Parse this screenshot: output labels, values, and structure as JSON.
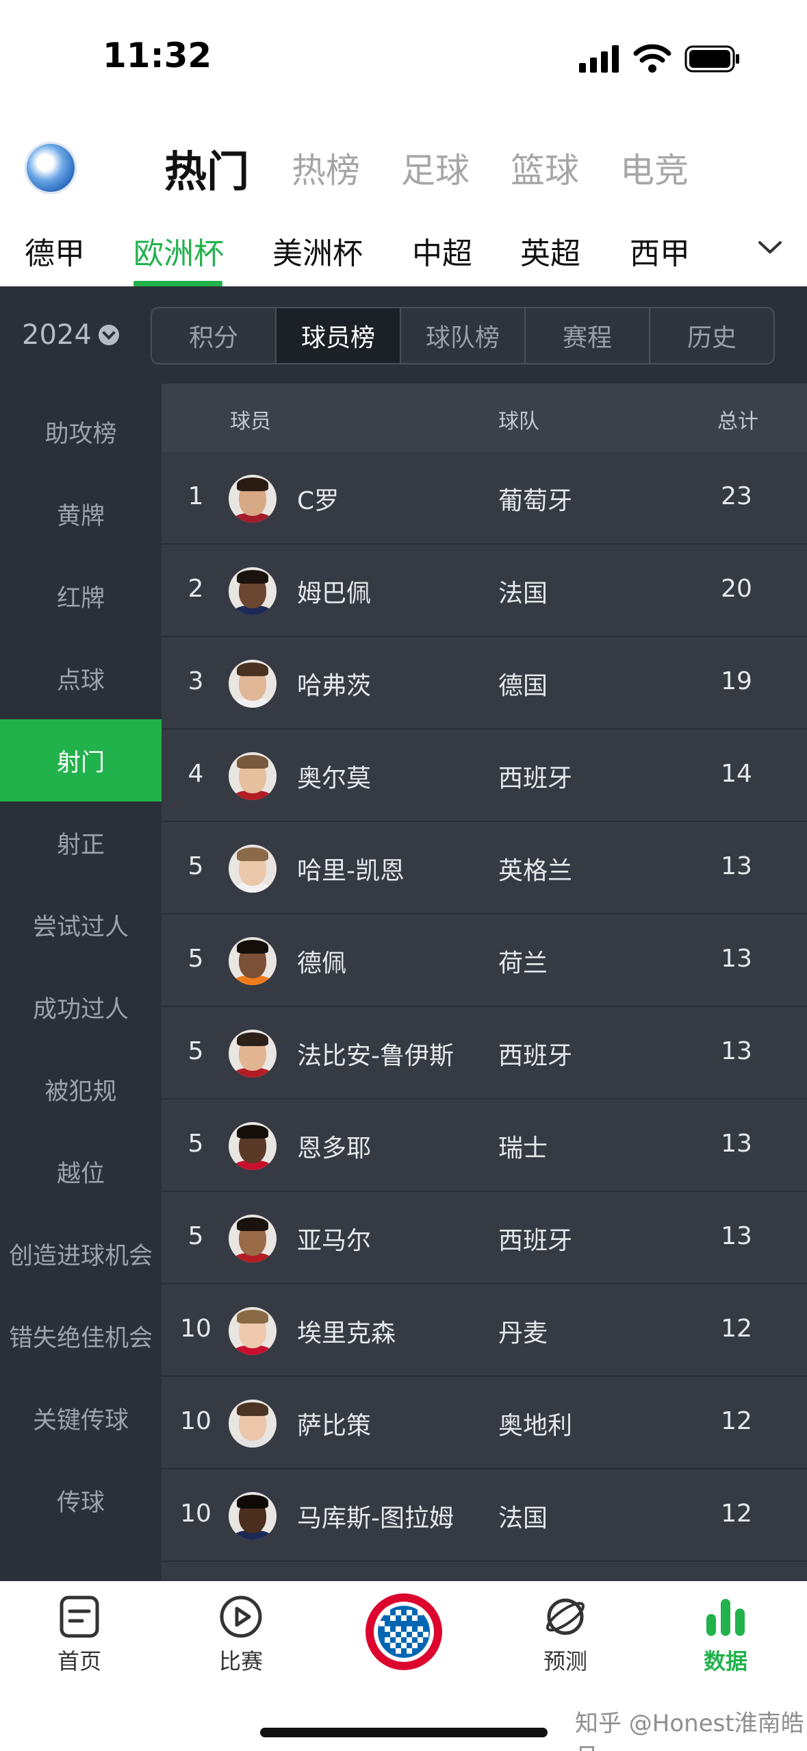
{
  "status_bar": {
    "time": "11:32"
  },
  "top_nav": {
    "tabs": [
      {
        "label": "热门",
        "active": true
      },
      {
        "label": "热榜",
        "active": false
      },
      {
        "label": "足球",
        "active": false
      },
      {
        "label": "篮球",
        "active": false
      },
      {
        "label": "电竞",
        "active": false
      }
    ]
  },
  "league_tabs": [
    {
      "label": "德甲",
      "active": false
    },
    {
      "label": "欧洲杯",
      "active": true
    },
    {
      "label": "美洲杯",
      "active": false
    },
    {
      "label": "中超",
      "active": false
    },
    {
      "label": "英超",
      "active": false
    },
    {
      "label": "西甲",
      "active": false
    }
  ],
  "season": {
    "year": "2024"
  },
  "segments": [
    {
      "label": "积分",
      "active": false
    },
    {
      "label": "球员榜",
      "active": true
    },
    {
      "label": "球队榜",
      "active": false
    },
    {
      "label": "赛程",
      "active": false
    },
    {
      "label": "历史",
      "active": false
    }
  ],
  "sidebar": [
    {
      "label": "助攻榜",
      "active": false
    },
    {
      "label": "黄牌",
      "active": false
    },
    {
      "label": "红牌",
      "active": false
    },
    {
      "label": "点球",
      "active": false
    },
    {
      "label": "射门",
      "active": true
    },
    {
      "label": "射正",
      "active": false
    },
    {
      "label": "尝试过人",
      "active": false
    },
    {
      "label": "成功过人",
      "active": false
    },
    {
      "label": "被犯规",
      "active": false
    },
    {
      "label": "越位",
      "active": false
    },
    {
      "label": "创造进球机会",
      "active": false
    },
    {
      "label": "错失绝佳机会",
      "active": false
    },
    {
      "label": "关键传球",
      "active": false
    },
    {
      "label": "传球",
      "active": false
    }
  ],
  "table": {
    "headers": {
      "player": "球员",
      "team": "球队",
      "total": "总计"
    },
    "rows": [
      {
        "rank": "1",
        "player": "C罗",
        "team": "葡萄牙",
        "total": "23",
        "skin": "#d7a884",
        "hair": "#2a1c12",
        "shirt": "#a31c2b"
      },
      {
        "rank": "2",
        "player": "姆巴佩",
        "team": "法国",
        "total": "20",
        "skin": "#6b4630",
        "hair": "#1a120c",
        "shirt": "#1c2a55"
      },
      {
        "rank": "3",
        "player": "哈弗茨",
        "team": "德国",
        "total": "19",
        "skin": "#e0b796",
        "hair": "#4a3222",
        "shirt": "#f0f0f0"
      },
      {
        "rank": "4",
        "player": "奥尔莫",
        "team": "西班牙",
        "total": "14",
        "skin": "#e6bf9f",
        "hair": "#7a5a3c",
        "shirt": "#b31d24"
      },
      {
        "rank": "5",
        "player": "哈里-凯恩",
        "team": "英格兰",
        "total": "13",
        "skin": "#ecc8aa",
        "hair": "#8a6a48",
        "shirt": "#f2f2f2"
      },
      {
        "rank": "5",
        "player": "德佩",
        "team": "荷兰",
        "total": "13",
        "skin": "#7a5036",
        "hair": "#140e0a",
        "shirt": "#f07b1c"
      },
      {
        "rank": "5",
        "player": "法比安-鲁伊斯",
        "team": "西班牙",
        "total": "13",
        "skin": "#e1b592",
        "hair": "#2c2018",
        "shirt": "#b31d24"
      },
      {
        "rank": "5",
        "player": "恩多耶",
        "team": "瑞士",
        "total": "13",
        "skin": "#5a3a26",
        "hair": "#140e0a",
        "shirt": "#c8102e"
      },
      {
        "rank": "5",
        "player": "亚马尔",
        "team": "西班牙",
        "total": "13",
        "skin": "#9a6a48",
        "hair": "#1a120c",
        "shirt": "#b31d24"
      },
      {
        "rank": "10",
        "player": "埃里克森",
        "team": "丹麦",
        "total": "12",
        "skin": "#eec9ad",
        "hair": "#8a6a44",
        "shirt": "#c8102e"
      },
      {
        "rank": "10",
        "player": "萨比策",
        "team": "奥地利",
        "total": "12",
        "skin": "#ecc6a8",
        "hair": "#4a3424",
        "shirt": "#e2e2e2"
      },
      {
        "rank": "10",
        "player": "马库斯-图拉姆",
        "team": "法国",
        "total": "12",
        "skin": "#4a2e1e",
        "hair": "#100a06",
        "shirt": "#1c2a55"
      }
    ]
  },
  "bottom_nav": [
    {
      "label": "首页",
      "icon": "document-icon",
      "active": false
    },
    {
      "label": "比赛",
      "icon": "play-icon",
      "active": false
    },
    {
      "label": "",
      "icon": "club-badge-icon",
      "active": false
    },
    {
      "label": "预测",
      "icon": "planet-icon",
      "active": false
    },
    {
      "label": "数据",
      "icon": "bar-chart-icon",
      "active": true
    }
  ],
  "credit": "知乎 @Honest淮南皓月",
  "colors": {
    "accent": "#22b24c",
    "dark_bg": "#2b3038",
    "table_bg": "#353a43"
  }
}
